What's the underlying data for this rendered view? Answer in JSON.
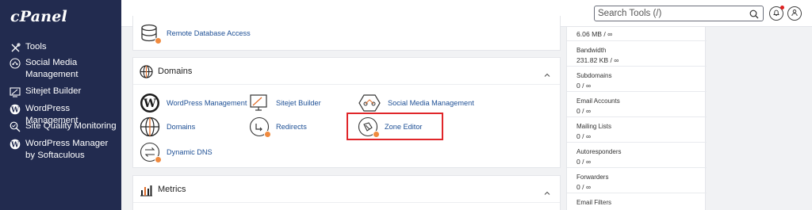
{
  "sidebar": {
    "logo": "cPanel",
    "items": [
      {
        "label": "Tools"
      },
      {
        "label": "Social Media Management"
      },
      {
        "label": "Sitejet Builder"
      },
      {
        "label": "WordPress Management"
      },
      {
        "label": "Site Quality Monitoring"
      },
      {
        "label": "WordPress Manager by Softaculous"
      }
    ]
  },
  "header": {
    "search_placeholder": "Search Tools (/)"
  },
  "main": {
    "top_tool": {
      "label": "Remote Database Access"
    },
    "domains": {
      "title": "Domains",
      "tools": [
        {
          "label": "WordPress Management"
        },
        {
          "label": "Sitejet Builder"
        },
        {
          "label": "Social Media Management"
        },
        {
          "label": "Domains"
        },
        {
          "label": "Redirects"
        },
        {
          "label": "Zone Editor"
        },
        {
          "label": "Dynamic DNS"
        }
      ]
    },
    "metrics": {
      "title": "Metrics"
    }
  },
  "stats": {
    "top_value": "6.06 MB / ∞",
    "items": [
      {
        "label": "Bandwidth",
        "value": "231.82 KB / ∞"
      },
      {
        "label": "Subdomains",
        "value": "0 / ∞"
      },
      {
        "label": "Email Accounts",
        "value": "0 / ∞"
      },
      {
        "label": "Mailing Lists",
        "value": "0 / ∞"
      },
      {
        "label": "Autoresponders",
        "value": "0 / ∞"
      },
      {
        "label": "Forwarders",
        "value": "0 / ∞"
      },
      {
        "label": "Email Filters",
        "value": ""
      }
    ]
  },
  "colors": {
    "sidebar_bg": "#222b4f",
    "link": "#1d4f95",
    "highlight": "#e0262a",
    "badge": "#f08a3e"
  }
}
